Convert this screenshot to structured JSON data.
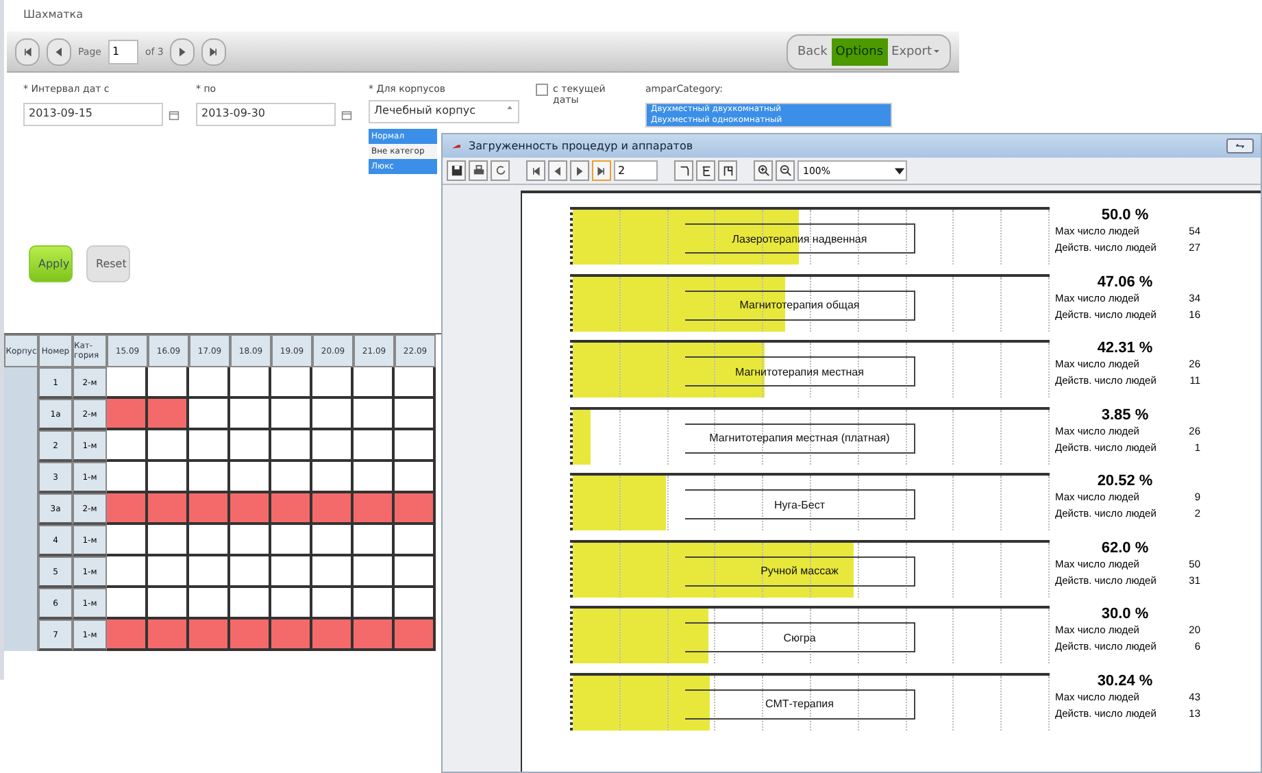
{
  "app": {
    "title": "Шахматка",
    "pager": {
      "page_label": "Page",
      "page": "1",
      "of": "of 3"
    },
    "actions": [
      {
        "label": "Back",
        "selected": false
      },
      {
        "label": "Options",
        "selected": true
      },
      {
        "label": "Export",
        "selected": false
      }
    ],
    "filters": {
      "date_from": {
        "label": "* Интервал дат с",
        "value": "2013-09-15"
      },
      "date_to": {
        "label": "* по",
        "value": "2013-09-30"
      },
      "building": {
        "label": "* Для корпусов",
        "value": "Лечебный корпус",
        "options": [
          {
            "label": "Нормал",
            "selected": true
          },
          {
            "label": "Вне категор",
            "selected": false
          },
          {
            "label": "Люкс",
            "selected": true
          }
        ]
      },
      "current_date": {
        "label": "с текущей даты",
        "checked": false
      },
      "category": {
        "label": "amparCategory:",
        "options": [
          {
            "label": "Двухместный двухкомнатный",
            "selected": true
          },
          {
            "label": "Двухместный однокомнатный",
            "selected": true
          }
        ]
      }
    },
    "buttons": [
      {
        "label": "Apply",
        "kind": "primary"
      },
      {
        "label": "Reset",
        "kind": "secondary"
      }
    ],
    "table": {
      "columns": [
        "Корпус",
        "Номер",
        "Кат-гория",
        "15.09",
        "16.09",
        "17.09",
        "18.09",
        "19.09",
        "20.09",
        "21.09",
        "22.09"
      ],
      "rows": [
        {
          "number": "1",
          "category": "2-м",
          "cells": [
            false,
            false,
            false,
            false,
            false,
            false,
            false,
            false
          ]
        },
        {
          "number": "1a",
          "category": "2-м",
          "cells": [
            true,
            true,
            false,
            false,
            false,
            false,
            false,
            false
          ]
        },
        {
          "number": "2",
          "category": "1-м",
          "cells": [
            false,
            false,
            false,
            false,
            false,
            false,
            false,
            false
          ]
        },
        {
          "number": "3",
          "category": "1-м",
          "cells": [
            false,
            false,
            false,
            false,
            false,
            false,
            false,
            false
          ]
        },
        {
          "number": "3a",
          "category": "2-м",
          "cells": [
            true,
            true,
            true,
            true,
            true,
            true,
            true,
            true
          ]
        },
        {
          "number": "4",
          "category": "1-м",
          "cells": [
            false,
            false,
            false,
            false,
            false,
            false,
            false,
            false
          ]
        },
        {
          "number": "5",
          "category": "1-м",
          "cells": [
            false,
            false,
            false,
            false,
            false,
            false,
            false,
            false
          ]
        },
        {
          "number": "6",
          "category": "1-м",
          "cells": [
            false,
            false,
            false,
            false,
            false,
            false,
            false,
            false
          ]
        },
        {
          "number": "7",
          "category": "1-м",
          "cells": [
            true,
            true,
            true,
            true,
            true,
            true,
            true,
            true
          ]
        }
      ]
    }
  },
  "report": {
    "title": "Загруженность процедур и аппаратов",
    "page": "2",
    "zoom": "100%",
    "rows": [
      {
        "name": "Лазеротерапия надвенная",
        "percent": "50.0 %",
        "level": 0.5,
        "max_label": "Мах число людей",
        "max": "54",
        "actual_label": "Действ. число людей",
        "actual": "27"
      },
      {
        "name": "Магнитотерапия общая",
        "percent": "47.06 %",
        "level": 0.4706,
        "max_label": "Мах число людей",
        "max": "34",
        "actual_label": "Действ. число людей",
        "actual": "16"
      },
      {
        "name": "Магнитотерапия местная",
        "percent": "42.31 %",
        "level": 0.4231,
        "max_label": "Мах число людей",
        "max": "26",
        "actual_label": "Действ. число людей",
        "actual": "11"
      },
      {
        "name": "Магнитотерапия местная (платная)",
        "percent": "3.85 %",
        "level": 0.0385,
        "max_label": "Мах число людей",
        "max": "26",
        "actual_label": "Действ. число людей",
        "actual": "1"
      },
      {
        "name": "Нуга-Бест",
        "percent": "20.52 %",
        "level": 0.2052,
        "max_label": "Мах число людей",
        "max": "9",
        "actual_label": "Действ. число людей",
        "actual": "2"
      },
      {
        "name": "Ручной массаж",
        "percent": "62.0 %",
        "level": 0.62,
        "max_label": "Мах число людей",
        "max": "50",
        "actual_label": "Действ. число людей",
        "actual": "31"
      },
      {
        "name": "Сюгра",
        "percent": "30.0 %",
        "level": 0.3,
        "max_label": "Мах число людей",
        "max": "20",
        "actual_label": "Действ. число людей",
        "actual": "6"
      },
      {
        "name": "СМТ-терапия",
        "percent": "30.24 %",
        "level": 0.3024,
        "max_label": "Мах число людей",
        "max": "43",
        "actual_label": "Действ. число людей",
        "actual": "13"
      }
    ]
  }
}
